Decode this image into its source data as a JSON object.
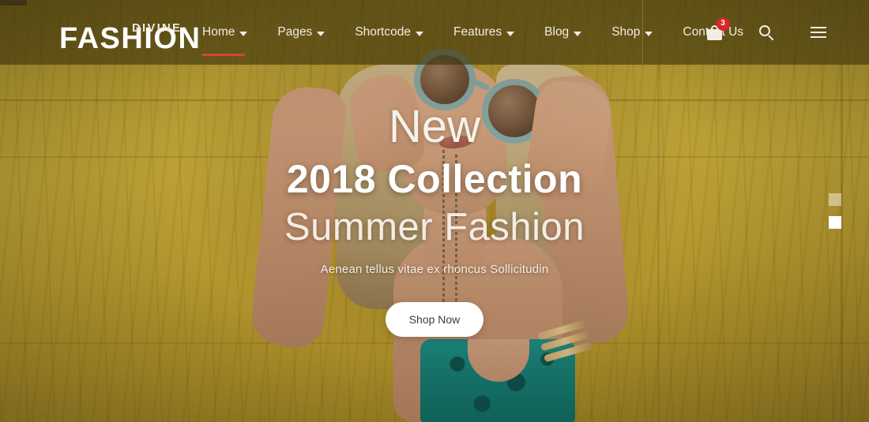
{
  "header": {
    "logo": {
      "main": "FASHION",
      "sub": "DIVINE"
    },
    "nav": [
      {
        "label": "Home",
        "has_caret": true,
        "active": true
      },
      {
        "label": "Pages",
        "has_caret": true,
        "active": false
      },
      {
        "label": "Shortcode",
        "has_caret": true,
        "active": false
      },
      {
        "label": "Features",
        "has_caret": true,
        "active": false
      },
      {
        "label": "Blog",
        "has_caret": true,
        "active": false
      },
      {
        "label": "Shop",
        "has_caret": true,
        "active": false
      },
      {
        "label": "Contact Us",
        "has_caret": false,
        "active": false
      }
    ],
    "icons": {
      "cart": "shopping-bag-icon",
      "cart_count": "3",
      "search": "search-icon",
      "menu": "hamburger-menu-icon"
    },
    "colors": {
      "overlay": "#3c320c",
      "accent_underline": "#d9433f",
      "badge": "#d8272c",
      "text": "#f2ece1"
    }
  },
  "hero": {
    "line_new": "New",
    "line_collection": "2018 Collection",
    "line_summer": "Summer Fashion",
    "subtitle": "Aenean tellus vitae ex rhoncus Sollicitudin",
    "cta_label": "Shop Now",
    "slides": [
      {
        "index": "1",
        "active": false
      },
      {
        "index": "2",
        "active": true
      }
    ]
  }
}
